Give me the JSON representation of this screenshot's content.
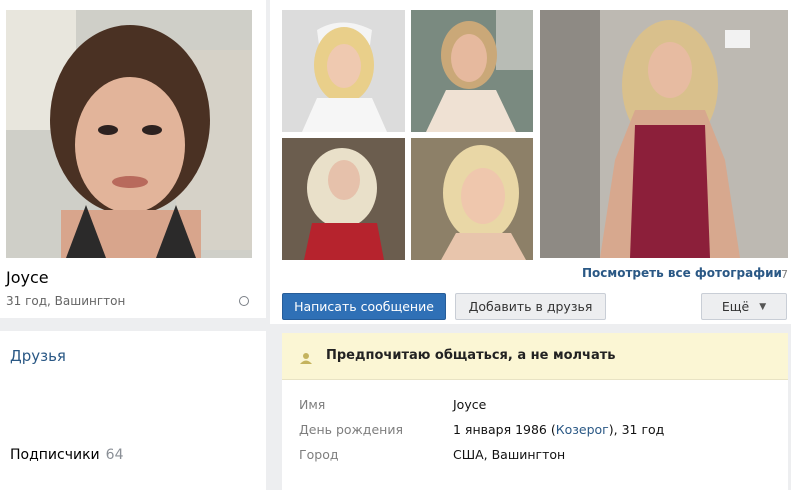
{
  "profile": {
    "name": "Joyce",
    "subtitle": "31 год, Вашингтон"
  },
  "sidebar": {
    "friends_label": "Друзья",
    "subscribers_label": "Подписчики",
    "subscribers_count": "64"
  },
  "photos": {
    "view_all_label": "Посмотреть все фотографии",
    "count": "7"
  },
  "actions": {
    "message_label": "Написать сообщение",
    "add_friend_label": "Добавить в друзья",
    "more_label": "Ещё"
  },
  "status": {
    "text": "Предпочитаю общаться, а не молчать"
  },
  "info": {
    "name_label": "Имя",
    "name_value": "Joyce",
    "birthday_label": "День рождения",
    "birthday_prefix": "1 января 1986 (",
    "birthday_sign": "Козерог",
    "birthday_suffix": "), 31 год",
    "city_label": "Город",
    "city_value": "США, Вашингтон"
  },
  "colors": {
    "link": "#2a5885",
    "primary_button": "#2f70b6",
    "status_background": "#fbf6d4"
  }
}
